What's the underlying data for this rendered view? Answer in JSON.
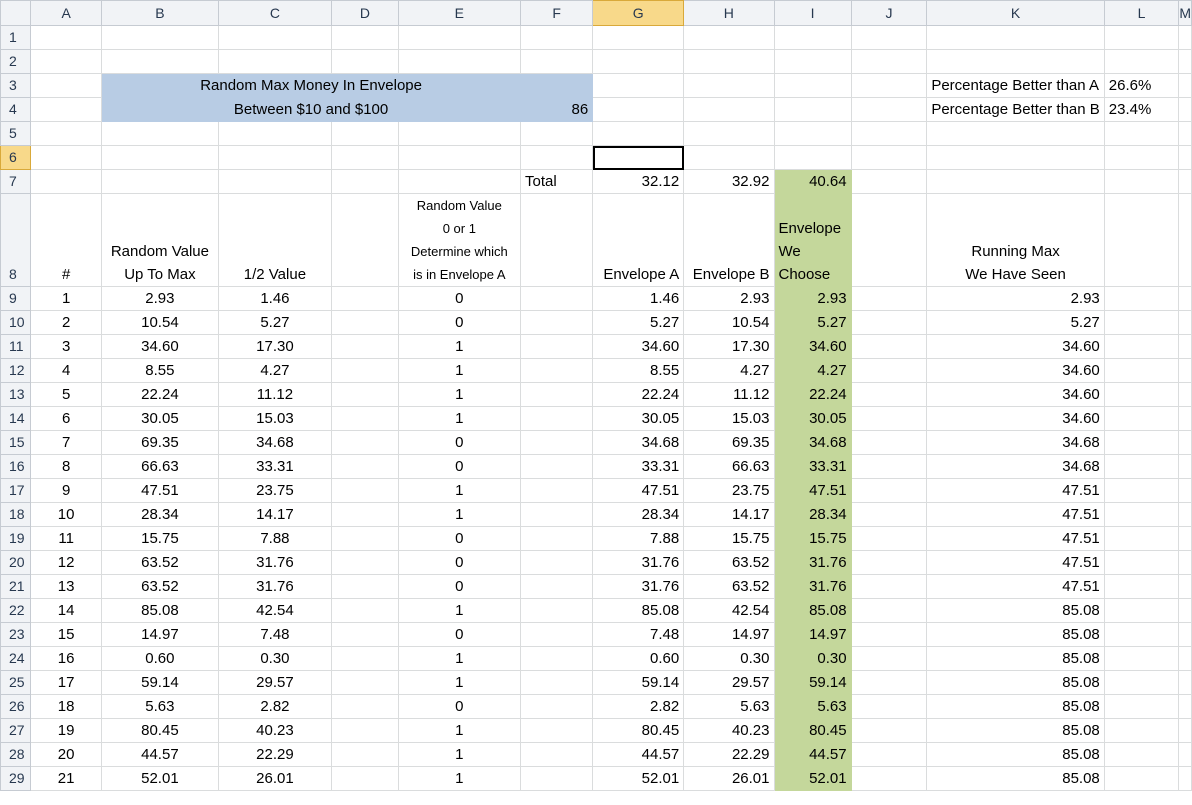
{
  "columns": [
    "A",
    "B",
    "C",
    "D",
    "E",
    "F",
    "G",
    "H",
    "I",
    "J",
    "K",
    "L",
    "M"
  ],
  "title_line1": "Random Max Money In Envelope",
  "title_line2": "Between $10 and $100",
  "max_value": "86",
  "pct_a_label": "Percentage Better than A",
  "pct_a_value": "26.6%",
  "pct_b_label": "Percentage Better than B",
  "pct_b_value": "23.4%",
  "total_label": "Total",
  "total_g": "32.12",
  "total_h": "32.92",
  "total_i": "40.64",
  "headers": {
    "hash": "#",
    "random_value_1": "Random Value",
    "random_value_2": "Up To Max",
    "half_value": "1/2 Value",
    "rv01_1": "Random Value",
    "rv01_2": "0 or 1",
    "rv01_3": "Determine which",
    "rv01_4": "is in Envelope A",
    "env_a": "Envelope A",
    "env_b": "Envelope B",
    "env_choose_1": "Envelope",
    "env_choose_2": "We",
    "env_choose_3": "Choose",
    "running_1": "Running Max",
    "running_2": "We Have Seen"
  },
  "rows": [
    {
      "n": "1",
      "b": "2.93",
      "c": "1.46",
      "e": "0",
      "g": "1.46",
      "h": "2.93",
      "i": "2.93",
      "k": "2.93"
    },
    {
      "n": "2",
      "b": "10.54",
      "c": "5.27",
      "e": "0",
      "g": "5.27",
      "h": "10.54",
      "i": "5.27",
      "k": "5.27"
    },
    {
      "n": "3",
      "b": "34.60",
      "c": "17.30",
      "e": "1",
      "g": "34.60",
      "h": "17.30",
      "i": "34.60",
      "k": "34.60"
    },
    {
      "n": "4",
      "b": "8.55",
      "c": "4.27",
      "e": "1",
      "g": "8.55",
      "h": "4.27",
      "i": "4.27",
      "k": "34.60"
    },
    {
      "n": "5",
      "b": "22.24",
      "c": "11.12",
      "e": "1",
      "g": "22.24",
      "h": "11.12",
      "i": "22.24",
      "k": "34.60"
    },
    {
      "n": "6",
      "b": "30.05",
      "c": "15.03",
      "e": "1",
      "g": "30.05",
      "h": "15.03",
      "i": "30.05",
      "k": "34.60"
    },
    {
      "n": "7",
      "b": "69.35",
      "c": "34.68",
      "e": "0",
      "g": "34.68",
      "h": "69.35",
      "i": "34.68",
      "k": "34.68"
    },
    {
      "n": "8",
      "b": "66.63",
      "c": "33.31",
      "e": "0",
      "g": "33.31",
      "h": "66.63",
      "i": "33.31",
      "k": "34.68"
    },
    {
      "n": "9",
      "b": "47.51",
      "c": "23.75",
      "e": "1",
      "g": "47.51",
      "h": "23.75",
      "i": "47.51",
      "k": "47.51"
    },
    {
      "n": "10",
      "b": "28.34",
      "c": "14.17",
      "e": "1",
      "g": "28.34",
      "h": "14.17",
      "i": "28.34",
      "k": "47.51"
    },
    {
      "n": "11",
      "b": "15.75",
      "c": "7.88",
      "e": "0",
      "g": "7.88",
      "h": "15.75",
      "i": "15.75",
      "k": "47.51"
    },
    {
      "n": "12",
      "b": "63.52",
      "c": "31.76",
      "e": "0",
      "g": "31.76",
      "h": "63.52",
      "i": "31.76",
      "k": "47.51"
    },
    {
      "n": "13",
      "b": "63.52",
      "c": "31.76",
      "e": "0",
      "g": "31.76",
      "h": "63.52",
      "i": "31.76",
      "k": "47.51"
    },
    {
      "n": "14",
      "b": "85.08",
      "c": "42.54",
      "e": "1",
      "g": "85.08",
      "h": "42.54",
      "i": "85.08",
      "k": "85.08"
    },
    {
      "n": "15",
      "b": "14.97",
      "c": "7.48",
      "e": "0",
      "g": "7.48",
      "h": "14.97",
      "i": "14.97",
      "k": "85.08"
    },
    {
      "n": "16",
      "b": "0.60",
      "c": "0.30",
      "e": "1",
      "g": "0.60",
      "h": "0.30",
      "i": "0.30",
      "k": "85.08"
    },
    {
      "n": "17",
      "b": "59.14",
      "c": "29.57",
      "e": "1",
      "g": "59.14",
      "h": "29.57",
      "i": "59.14",
      "k": "85.08"
    },
    {
      "n": "18",
      "b": "5.63",
      "c": "2.82",
      "e": "0",
      "g": "2.82",
      "h": "5.63",
      "i": "5.63",
      "k": "85.08"
    },
    {
      "n": "19",
      "b": "80.45",
      "c": "40.23",
      "e": "1",
      "g": "80.45",
      "h": "40.23",
      "i": "80.45",
      "k": "85.08"
    },
    {
      "n": "20",
      "b": "44.57",
      "c": "22.29",
      "e": "1",
      "g": "44.57",
      "h": "22.29",
      "i": "44.57",
      "k": "85.08"
    },
    {
      "n": "21",
      "b": "52.01",
      "c": "26.01",
      "e": "1",
      "g": "52.01",
      "h": "26.01",
      "i": "52.01",
      "k": "85.08"
    }
  ],
  "colors": {
    "title_fill": "#b8cce4",
    "choose_fill": "#c4d79b",
    "selected_header": "#f8d98a"
  }
}
